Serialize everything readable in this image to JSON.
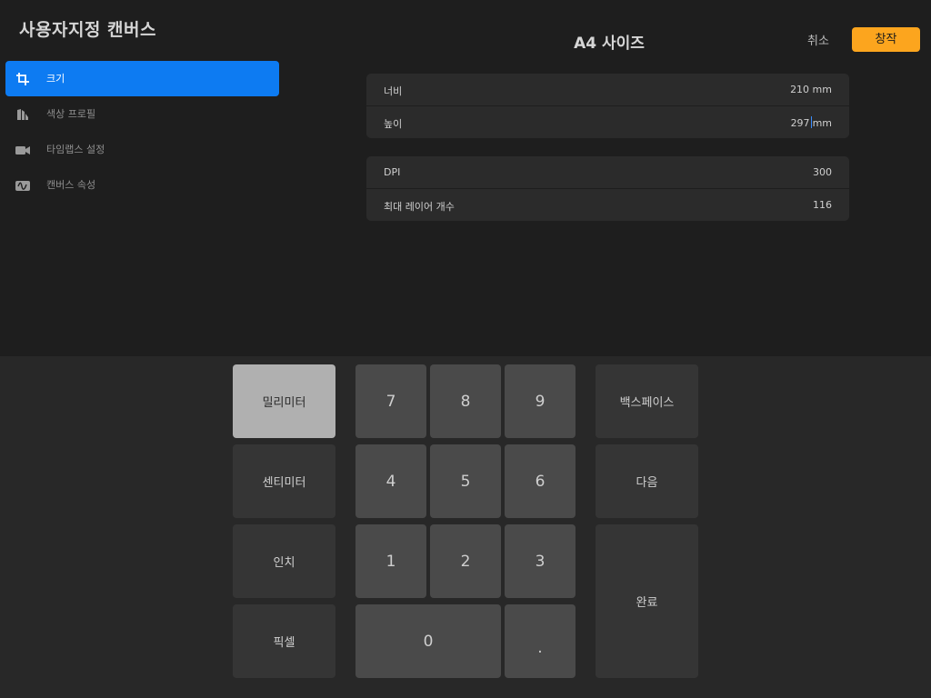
{
  "header": {
    "app_title": "사용자지정 캔버스",
    "canvas_title": "A4 사이즈",
    "cancel_label": "취소",
    "create_label": "창작"
  },
  "sidebar": {
    "items": [
      {
        "label": "크기",
        "icon": "crop-icon",
        "active": true
      },
      {
        "label": "색상 프로필",
        "icon": "color-profile-icon",
        "active": false
      },
      {
        "label": "타임랩스 설정",
        "icon": "video-camera-icon",
        "active": false
      },
      {
        "label": "캔버스 속성",
        "icon": "canvas-properties-icon",
        "active": false
      }
    ]
  },
  "size_panel": {
    "width_label": "너비",
    "width_value": "210 mm",
    "height_label": "높이",
    "height_value_number": "297",
    "height_value_unit": "mm"
  },
  "dpi_panel": {
    "dpi_label": "DPI",
    "dpi_value": "300",
    "layers_label": "최대 레이어 개수",
    "layers_value": "116"
  },
  "keyboard": {
    "units": [
      "밀리미터",
      "센티미터",
      "인치",
      "픽셀"
    ],
    "active_unit": "밀리미터",
    "keys": [
      "7",
      "8",
      "9",
      "4",
      "5",
      "6",
      "1",
      "2",
      "3",
      "0",
      "."
    ],
    "backspace_label": "백스페이스",
    "next_label": "다음",
    "done_label": "완료"
  },
  "colors": {
    "accent": "#0d7bf2",
    "create_button": "#fca51e"
  }
}
